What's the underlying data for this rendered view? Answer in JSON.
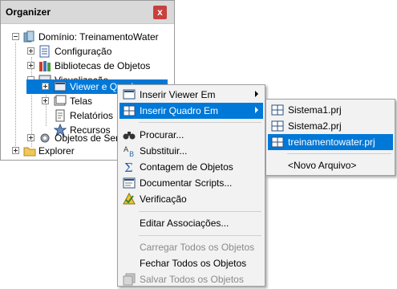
{
  "organizer": {
    "title": "Organizer",
    "close_label": "x",
    "items": [
      {
        "label": "Domínio: TreinamentoWater"
      },
      {
        "label": "Configuração"
      },
      {
        "label": "Bibliotecas de Objetos"
      },
      {
        "label": "Visualização"
      },
      {
        "label": "Viewer e Quadros"
      },
      {
        "label": "Telas"
      },
      {
        "label": "Relatórios"
      },
      {
        "label": "Recursos"
      },
      {
        "label": "Objetos de Serviço"
      },
      {
        "label": "Explorer"
      }
    ]
  },
  "context_menu": {
    "items": [
      {
        "label": "Inserir Viewer Em"
      },
      {
        "label": "Inserir Quadro Em"
      },
      {
        "label": "Procurar..."
      },
      {
        "label": "Substituir..."
      },
      {
        "label": "Contagem de Objetos"
      },
      {
        "label": "Documentar Scripts..."
      },
      {
        "label": "Verificação"
      },
      {
        "label": "Editar Associações..."
      },
      {
        "label": "Carregar Todos os Objetos"
      },
      {
        "label": "Fechar Todos os Objetos"
      },
      {
        "label": "Salvar Todos os Objetos"
      }
    ]
  },
  "submenu": {
    "items": [
      {
        "label": "Sistema1.prj"
      },
      {
        "label": "Sistema2.prj"
      },
      {
        "label": "treinamentowater.prj"
      },
      {
        "label": "<Novo Arquivo>"
      }
    ]
  },
  "colors": {
    "selection": "#0078d7",
    "close_button": "#c7413f",
    "menu_bg": "#f2f2f2"
  }
}
